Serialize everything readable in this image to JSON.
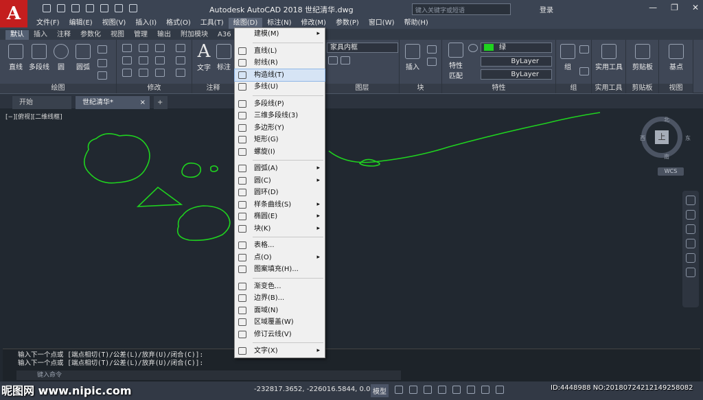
{
  "app": {
    "logo": "A",
    "title": "Autodesk AutoCAD 2018    世纪清华.dwg",
    "search_placeholder": "键入关键字或短语",
    "login": "登录",
    "win_controls": [
      "—",
      "❐",
      "✕"
    ]
  },
  "menubar": [
    "文件(F)",
    "编辑(E)",
    "视图(V)",
    "插入(I)",
    "格式(O)",
    "工具(T)",
    "绘图(D)",
    "标注(N)",
    "修改(M)",
    "参数(P)",
    "窗口(W)",
    "帮助(H)"
  ],
  "ribbon_tabs": [
    "默认",
    "插入",
    "注释",
    "参数化",
    "视图",
    "管理",
    "输出",
    "附加模块",
    "A36"
  ],
  "draw_tools": [
    "直线",
    "多段线",
    "圆",
    "圆弧"
  ],
  "panels": {
    "draw": "绘图",
    "modify": "修改",
    "annot": "注释",
    "layers": "图层",
    "block": "块",
    "props": "特性",
    "group": "组",
    "utils": "实用工具",
    "clip": "剪贴板",
    "view": "视图"
  },
  "annot_tools": [
    "文字",
    "标注"
  ],
  "layer_dropdown": "家具内框",
  "block_tool": "插入",
  "props_tools": [
    "特性",
    "匹配"
  ],
  "color_value": "绿",
  "linetype": "ByLayer",
  "lineweight": "ByLayer",
  "group_tool": "组",
  "utils_tool": "实用工具",
  "clip_tool": "剪贴板",
  "base_tool": "基点",
  "doc_tabs": {
    "start": "开始",
    "doc": "世纪清华*",
    "plus": "+"
  },
  "viewport_label": "[−][俯视][二维线框]",
  "viewcube": {
    "face": "上",
    "n": "北",
    "s": "南",
    "e": "东",
    "w": "西",
    "wcs": "WCS"
  },
  "draw_menu": {
    "items": [
      {
        "label": "建模(M)",
        "sub": true
      },
      {
        "sep": true
      },
      {
        "label": "直线(L)"
      },
      {
        "label": "射线(R)"
      },
      {
        "label": "构造线(T)",
        "hl": true
      },
      {
        "label": "多线(U)"
      },
      {
        "sep": true
      },
      {
        "label": "多段线(P)"
      },
      {
        "label": "三维多段线(3)"
      },
      {
        "label": "多边形(Y)"
      },
      {
        "label": "矩形(G)"
      },
      {
        "label": "螺旋(I)"
      },
      {
        "sep": true
      },
      {
        "label": "圆弧(A)",
        "sub": true
      },
      {
        "label": "圆(C)",
        "sub": true
      },
      {
        "label": "圆环(D)"
      },
      {
        "label": "样条曲线(S)",
        "sub": true
      },
      {
        "label": "椭圆(E)",
        "sub": true
      },
      {
        "label": "块(K)",
        "sub": true
      },
      {
        "sep": true
      },
      {
        "label": "表格..."
      },
      {
        "label": "点(O)",
        "sub": true
      },
      {
        "label": "图案填充(H)..."
      },
      {
        "sep": true
      },
      {
        "label": "渐变色..."
      },
      {
        "label": "边界(B)..."
      },
      {
        "label": "面域(N)"
      },
      {
        "label": "区域覆盖(W)"
      },
      {
        "label": "修订云线(V)"
      },
      {
        "sep": true
      },
      {
        "label": "文字(X)",
        "sub": true
      }
    ]
  },
  "command": {
    "lines": [
      "输入下一个点或 [端点相切(T)/公差(L)/放弃(U)/闭合(C)]:",
      "输入下一个点或 [端点相切(T)/公差(L)/放弃(U)/闭合(C)]:"
    ],
    "placeholder": "键入命令"
  },
  "status": {
    "coords": "-232817.3652, -226016.5844, 0.0000",
    "model": "模型"
  },
  "overlay": {
    "watermark": "昵图网 www.nipic.com",
    "id": "ID:4448988 NO:20180724212149258082"
  },
  "colors": {
    "drawing": "#1fd31f",
    "canvas": "#212830"
  }
}
